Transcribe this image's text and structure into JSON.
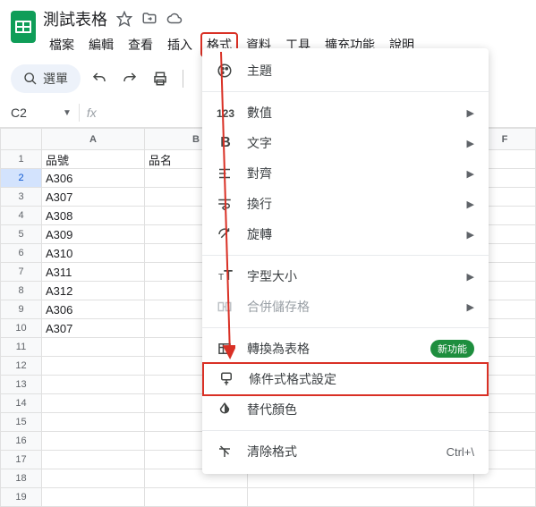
{
  "doc": {
    "title": "測試表格"
  },
  "menubar": [
    "檔案",
    "編輯",
    "查看",
    "插入",
    "格式",
    "資料",
    "工具",
    "擴充功能",
    "說明"
  ],
  "menubar_active_index": 4,
  "toolbar": {
    "search_label": "選單"
  },
  "cellref": {
    "ref": "C2"
  },
  "columns": [
    "A",
    "B",
    "F"
  ],
  "rows": [
    {
      "n": 1,
      "a": "品號",
      "b": "品名"
    },
    {
      "n": 2,
      "a": "A306",
      "b": ""
    },
    {
      "n": 3,
      "a": "A307",
      "b": ""
    },
    {
      "n": 4,
      "a": "A308",
      "b": ""
    },
    {
      "n": 5,
      "a": "A309",
      "b": ""
    },
    {
      "n": 6,
      "a": "A310",
      "b": ""
    },
    {
      "n": 7,
      "a": "A311",
      "b": ""
    },
    {
      "n": 8,
      "a": "A312",
      "b": ""
    },
    {
      "n": 9,
      "a": "A306",
      "b": ""
    },
    {
      "n": 10,
      "a": "A307",
      "b": ""
    },
    {
      "n": 11,
      "a": "",
      "b": ""
    },
    {
      "n": 12,
      "a": "",
      "b": ""
    },
    {
      "n": 13,
      "a": "",
      "b": ""
    },
    {
      "n": 14,
      "a": "",
      "b": ""
    },
    {
      "n": 15,
      "a": "",
      "b": ""
    },
    {
      "n": 16,
      "a": "",
      "b": ""
    },
    {
      "n": 17,
      "a": "",
      "b": ""
    },
    {
      "n": 18,
      "a": "",
      "b": ""
    },
    {
      "n": 19,
      "a": "",
      "b": ""
    }
  ],
  "selected_row": 2,
  "dropdown": {
    "items": [
      {
        "icon": "theme",
        "label": "主題",
        "submenu": false
      },
      {
        "divider": true
      },
      {
        "icon": "number",
        "label": "數值",
        "submenu": true
      },
      {
        "icon": "bold",
        "label": "文字",
        "submenu": true
      },
      {
        "icon": "align",
        "label": "對齊",
        "submenu": true
      },
      {
        "icon": "wrap",
        "label": "換行",
        "submenu": true
      },
      {
        "icon": "rotate",
        "label": "旋轉",
        "submenu": true
      },
      {
        "divider": true
      },
      {
        "icon": "fontsize",
        "label": "字型大小",
        "submenu": true
      },
      {
        "icon": "merge",
        "label": "合併儲存格",
        "submenu": true,
        "disabled": true
      },
      {
        "divider": true
      },
      {
        "icon": "table",
        "label": "轉換為表格",
        "badge": "新功能"
      },
      {
        "icon": "cond",
        "label": "條件式格式設定",
        "highlighted": true
      },
      {
        "icon": "altcolor",
        "label": "替代顏色"
      },
      {
        "divider": true
      },
      {
        "icon": "clear",
        "label": "清除格式",
        "shortcut": "Ctrl+\\"
      }
    ]
  }
}
